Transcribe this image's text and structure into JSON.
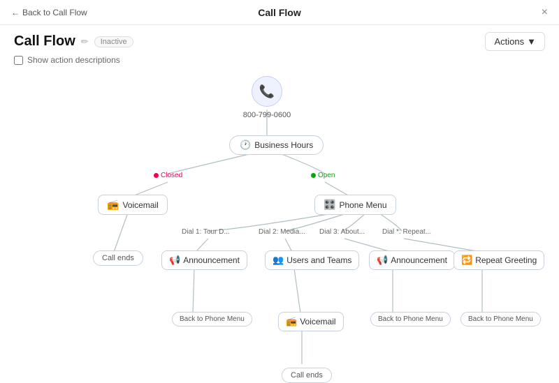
{
  "header": {
    "back_label": "Back to Call Flow",
    "title": "Call Flow",
    "close": "×"
  },
  "page": {
    "title": "Call Flow",
    "badge": "Inactive",
    "edit_icon": "✏",
    "show_descriptions_label": "Show action descriptions",
    "actions_label": "Actions"
  },
  "nodes": {
    "phone_number": "800-799-0600",
    "business_hours": "Business Hours",
    "closed_label": "Closed",
    "open_label": "Open",
    "voicemail": "Voicemail",
    "phone_menu": "Phone Menu",
    "call_ends_1": "Call ends",
    "announcement_1": "Announcement",
    "users_teams": "Users and Teams",
    "announcement_2": "Announcement",
    "repeat_greeting": "Repeat Greeting",
    "dial_1": "Dial 1: Tour D...",
    "dial_2": "Dial 2: Media...",
    "dial_3": "Dial 3: About...",
    "dial_4": "Dial *: Repeat...",
    "back_phone_1": "Back to Phone Menu",
    "voicemail_2": "Voicemail",
    "back_phone_2": "Back to Phone Menu",
    "back_phone_3": "Back to Phone Menu",
    "call_ends_2": "Call ends"
  }
}
